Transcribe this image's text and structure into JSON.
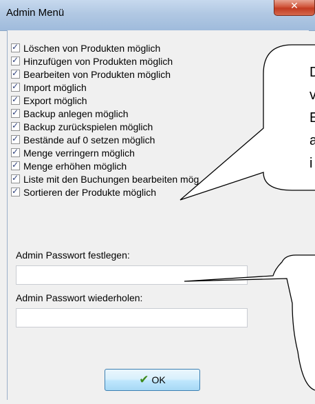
{
  "window": {
    "title": "Admin Menü"
  },
  "checkboxes": [
    {
      "label": "Löschen von Produkten möglich",
      "checked": true
    },
    {
      "label": "Hinzufügen von Produkten möglich",
      "checked": true
    },
    {
      "label": "Bearbeiten von Produkten möglich",
      "checked": true
    },
    {
      "label": "Import möglich",
      "checked": true
    },
    {
      "label": "Export möglich",
      "checked": true
    },
    {
      "label": "Backup anlegen möglich",
      "checked": true
    },
    {
      "label": "Backup zurückspielen möglich",
      "checked": true
    },
    {
      "label": "Bestände auf 0 setzen möglich",
      "checked": true
    },
    {
      "label": "Menge verringern möglich",
      "checked": true
    },
    {
      "label": "Menge erhöhen möglich",
      "checked": true
    },
    {
      "label": "Liste mit den Buchungen bearbeiten mög",
      "checked": true
    },
    {
      "label": "Sortieren der Produkte möglich",
      "checked": true
    }
  ],
  "password": {
    "set_label": "Admin Passwort festlegen:",
    "set_value": "",
    "repeat_label": "Admin Passwort wiederholen:",
    "repeat_value": ""
  },
  "ok_button": {
    "label": "OK"
  },
  "callouts": [
    {
      "lines": [
        "D",
        "v",
        "E",
        "a",
        "i"
      ]
    }
  ]
}
